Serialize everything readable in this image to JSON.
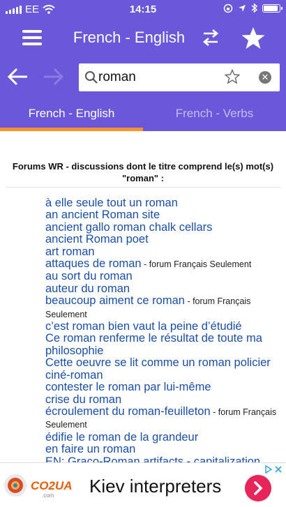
{
  "status_bar": {
    "carrier": "EE",
    "time": "14:15",
    "battery_level": 0.9,
    "icons": [
      "signal-icon",
      "wifi-icon",
      "lock-rotation-icon",
      "location-icon",
      "bluetooth-icon",
      "battery-icon"
    ]
  },
  "header": {
    "title": "French - English",
    "icons": [
      "menu-icon",
      "swap-icon",
      "star-icon"
    ]
  },
  "search": {
    "value": "roman",
    "icons": [
      "back-arrow-icon",
      "forward-arrow-icon",
      "search-icon",
      "favorite-star-icon",
      "clear-icon"
    ],
    "clear_glyph": "✕"
  },
  "tabs": [
    {
      "label": "French - English",
      "active": true
    },
    {
      "label": "French - Verbs",
      "active": false
    }
  ],
  "forum": {
    "heading_line1": "Forums WR - discussions dont le titre comprend le(s) mot(s)",
    "heading_line2": "\"roman\" :",
    "results": [
      {
        "text": "à elle seule tout un roman",
        "note": ""
      },
      {
        "text": "an ancient Roman site",
        "note": ""
      },
      {
        "text": "ancient gallo roman chalk cellars",
        "note": ""
      },
      {
        "text": "ancient Roman poet",
        "note": ""
      },
      {
        "text": "art roman",
        "note": ""
      },
      {
        "text": "attaques de roman",
        "note": " - forum Français Seulement"
      },
      {
        "text": "au sort du roman",
        "note": ""
      },
      {
        "text": "auteur du roman",
        "note": ""
      },
      {
        "text": "beaucoup aiment ce roman",
        "note": " - forum Français Seulement"
      },
      {
        "text": "c’est roman bien vaut la peine d’étudié",
        "note": ""
      },
      {
        "text": "Ce roman renferme le résultat de toute ma philosophie",
        "note": ""
      },
      {
        "text": "Cette oeuvre se lit comme un roman policier",
        "note": ""
      },
      {
        "text": "ciné-roman",
        "note": ""
      },
      {
        "text": "contester le roman par lui-même",
        "note": ""
      },
      {
        "text": "crise du roman",
        "note": ""
      },
      {
        "text": "écroulement du roman-feuilleton",
        "note": " - forum Français Seulement"
      },
      {
        "text": "édifie le roman de la grandeur",
        "note": ""
      },
      {
        "text": "en faire un roman",
        "note": ""
      },
      {
        "text": "EN: Graco-Roman artifacts - capitalization",
        "note": ""
      }
    ]
  },
  "ad": {
    "logo_text": "CO2UA",
    "logo_sub": ".com",
    "title": "Kiev interpreters",
    "icons": [
      "ad-logo-icon",
      "ad-arrow-icon",
      "ad-choices-icon"
    ]
  },
  "colors": {
    "primary": "#6a57d9",
    "accent": "#f7932b",
    "link": "#1a4fa8",
    "tab_inactive": "#c6bdf0",
    "ad_button": "#e8255a"
  }
}
